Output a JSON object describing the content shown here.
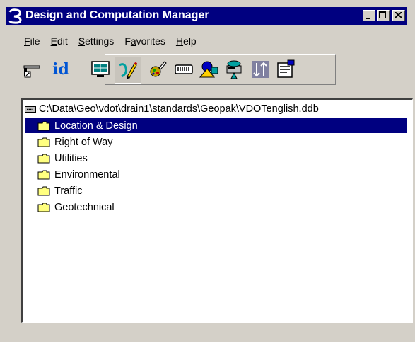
{
  "window": {
    "title": "Design and Computation Manager"
  },
  "menu": [
    {
      "ul": "F",
      "rest": "ile"
    },
    {
      "ul": "E",
      "rest": "dit"
    },
    {
      "ul": "S",
      "rest": "ettings"
    },
    {
      "pre": "F",
      "ul": "a",
      "rest": "vorites"
    },
    {
      "ul": "H",
      "rest": "elp"
    }
  ],
  "toolbar": {
    "id_label": "id"
  },
  "tree": {
    "root": "C:\\Data\\Geo\\vdot\\drain1\\standards\\Geopak\\VDOTenglish.ddb",
    "items": [
      {
        "label": "Location & Design",
        "selected": true
      },
      {
        "label": "Right of Way"
      },
      {
        "label": "Utilities"
      },
      {
        "label": "Environmental"
      },
      {
        "label": "Traffic"
      },
      {
        "label": "Geotechnical"
      }
    ]
  },
  "colors": {
    "title_bar": "#000080",
    "selection": "#000080",
    "face": "#d4d0c8"
  }
}
